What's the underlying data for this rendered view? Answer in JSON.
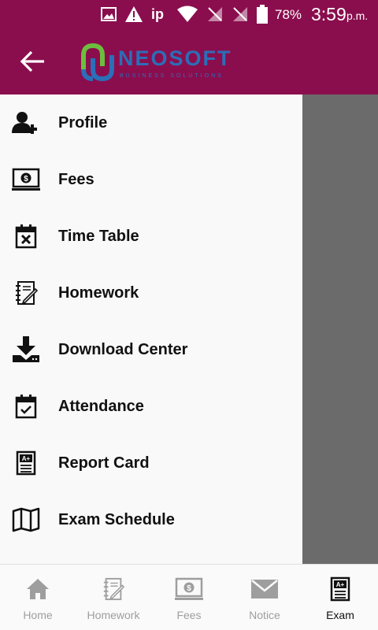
{
  "status_bar": {
    "ip": "ip",
    "battery": "78%",
    "time": "3:59",
    "ampm": "p.m."
  },
  "app_bar": {
    "logo_text": "NEOSOFT",
    "logo_tagline": "BUSINESS SOLUTIONS"
  },
  "drawer": {
    "items": [
      {
        "label": "Profile",
        "icon": "add-user-icon"
      },
      {
        "label": "Fees",
        "icon": "money-icon"
      },
      {
        "label": "Time Table",
        "icon": "calendar-x-icon"
      },
      {
        "label": "Homework",
        "icon": "notebook-pencil-icon"
      },
      {
        "label": "Download Center",
        "icon": "download-icon"
      },
      {
        "label": "Attendance",
        "icon": "calendar-check-icon"
      },
      {
        "label": "Report Card",
        "icon": "report-card-icon"
      },
      {
        "label": "Exam Schedule",
        "icon": "map-icon"
      }
    ]
  },
  "bottom_nav": {
    "items": [
      {
        "label": "Home",
        "icon": "home-icon",
        "active": false
      },
      {
        "label": "Homework",
        "icon": "notebook-pencil-icon",
        "active": false
      },
      {
        "label": "Fees",
        "icon": "money-icon",
        "active": false
      },
      {
        "label": "Notice",
        "icon": "mail-icon",
        "active": false
      },
      {
        "label": "Exam",
        "icon": "report-card-icon",
        "active": true
      }
    ]
  },
  "colors": {
    "primary": "#8a0e4e",
    "scrim": "#6b6b6b",
    "logo_green": "#6cbf3c",
    "logo_blue": "#2a6fb8",
    "inactive": "#9e9e9e"
  }
}
